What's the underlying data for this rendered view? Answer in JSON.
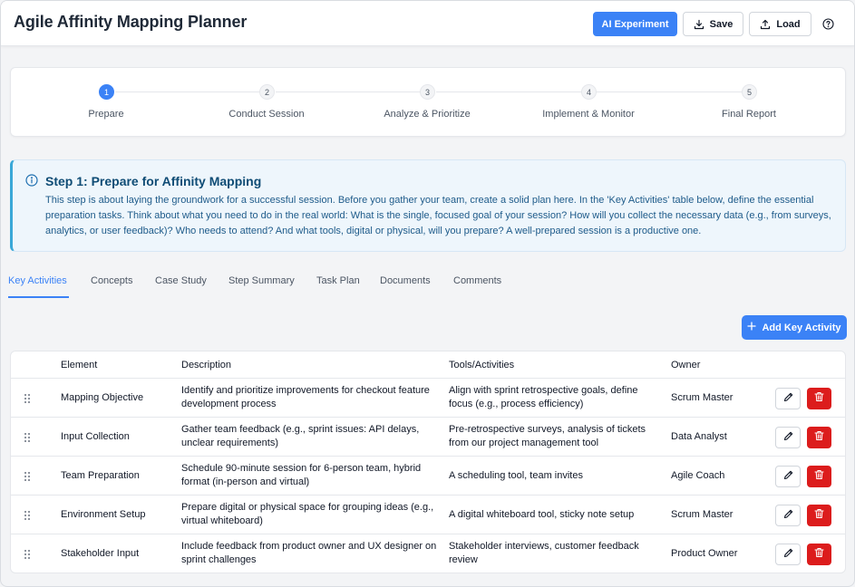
{
  "header": {
    "title": "Agile Affinity Mapping Planner",
    "ai_label": "AI Experiment",
    "save_label": "Save",
    "load_label": "Load",
    "icons": {
      "save": "download-icon",
      "load": "upload-icon",
      "help": "help-circle-icon"
    }
  },
  "stepper": {
    "active_step": 1,
    "steps": [
      {
        "number": "1",
        "label": "Prepare"
      },
      {
        "number": "2",
        "label": "Conduct Session"
      },
      {
        "number": "3",
        "label": "Analyze & Prioritize"
      },
      {
        "number": "4",
        "label": "Implement & Monitor"
      },
      {
        "number": "5",
        "label": "Final Report"
      }
    ]
  },
  "info": {
    "icon": "info-icon",
    "title": "Step 1: Prepare for Affinity Mapping",
    "text": "This step is about laying the groundwork for a successful session. Before you gather your team, create a solid plan here. In the 'Key Activities' table below, define the essential preparation tasks. Think about what you need to do in the real world: What is the single, focused goal of your session? How will you collect the necessary data (e.g., from surveys, analytics, or user feedback)? Who needs to attend? And what tools, digital or physical, will you prepare? A well-prepared session is a productive one."
  },
  "tabs": [
    {
      "label": "Key Activities",
      "active": true
    },
    {
      "label": "Concepts",
      "active": false
    },
    {
      "label": "Case Study",
      "active": false
    },
    {
      "label": "Step Summary",
      "active": false
    },
    {
      "label": "Task Plan",
      "active": false
    },
    {
      "label": "Documents",
      "active": false
    },
    {
      "label": "Comments",
      "active": false
    }
  ],
  "add_button_label": "Add Key Activity",
  "table": {
    "columns": [
      "Element",
      "Description",
      "Tools/Activities",
      "Owner"
    ],
    "rows": [
      {
        "element": "Mapping Objective",
        "description": "Identify and prioritize improvements for checkout feature development process",
        "tools": "Align with sprint retrospective goals, define focus (e.g., process efficiency)",
        "owner": "Scrum Master"
      },
      {
        "element": "Input Collection",
        "description": "Gather team feedback (e.g., sprint issues: API delays, unclear requirements)",
        "tools": "Pre-retrospective surveys, analysis of tickets from our project management tool",
        "owner": "Data Analyst"
      },
      {
        "element": "Team Preparation",
        "description": "Schedule 90-minute session for 6-person team, hybrid format (in-person and virtual)",
        "tools": "A scheduling tool, team invites",
        "owner": "Agile Coach"
      },
      {
        "element": "Environment Setup",
        "description": "Prepare digital or physical space for grouping ideas (e.g., virtual whiteboard)",
        "tools": "A digital whiteboard tool, sticky note setup",
        "owner": "Scrum Master"
      },
      {
        "element": "Stakeholder Input",
        "description": "Include feedback from product owner and UX designer on sprint challenges",
        "tools": "Stakeholder interviews, customer feedback review",
        "owner": "Product Owner"
      }
    ]
  },
  "colors": {
    "accent": "#3b82f6",
    "danger": "#dc1c1c",
    "info_bg": "#eef6fc",
    "info_border": "#3aa8d8",
    "info_text": "#1e5b8a"
  }
}
